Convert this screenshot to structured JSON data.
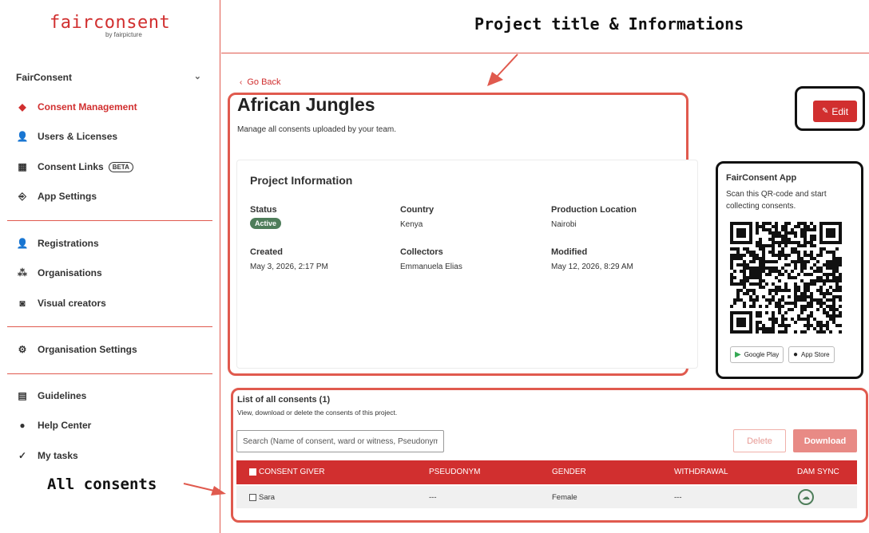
{
  "sidebar": {
    "logo": "fairconsent",
    "logo_sub": "by fairpicture",
    "section": "FairConsent",
    "items": [
      {
        "label": "Consent Management",
        "icon": "consent-icon"
      },
      {
        "label": "Users & Licenses",
        "icon": "users-icon"
      },
      {
        "label": "Consent Links",
        "icon": "qr-links-icon",
        "badge": "BETA"
      },
      {
        "label": "App Settings",
        "icon": "app-settings-icon"
      },
      {
        "label": "Registrations",
        "icon": "add-user-icon"
      },
      {
        "label": "Organisations",
        "icon": "organisations-icon"
      },
      {
        "label": "Visual creators",
        "icon": "camera-icon"
      },
      {
        "label": "Organisation Settings",
        "icon": "gear-icon"
      },
      {
        "label": "Guidelines",
        "icon": "book-icon"
      },
      {
        "label": "Help Center",
        "icon": "help-icon"
      },
      {
        "label": "My tasks",
        "icon": "check-circle-icon"
      }
    ]
  },
  "annotations": {
    "top": "Project title & Informations",
    "consents": "All consents"
  },
  "main": {
    "go_back": "Go Back",
    "title": "African Jungles",
    "subtitle": "Manage all consents uploaded by your team.",
    "edit_label": "Edit"
  },
  "project_info": {
    "heading": "Project Information",
    "status_label": "Status",
    "status_value": "Active",
    "country_label": "Country",
    "country_value": "Kenya",
    "location_label": "Production Location",
    "location_value": "Nairobi",
    "created_label": "Created",
    "created_value": "May 3, 2026, 2:17 PM",
    "collectors_label": "Collectors",
    "collectors_value": "Emmanuela Elias",
    "modified_label": "Modified",
    "modified_value": "May 12, 2026, 8:29 AM"
  },
  "app_card": {
    "title": "FairConsent App",
    "desc": "Scan this QR-code and start collecting consents.",
    "google_play": "Google Play",
    "app_store": "App Store"
  },
  "consents": {
    "title": "List of all consents (1)",
    "subtitle": "View, download or delete the consents of this project.",
    "search_placeholder": "Search (Name of consent, ward or witness, Pseudonym)",
    "delete_label": "Delete",
    "download_label": "Download",
    "columns": [
      "CONSENT GIVER",
      "PSEUDONYM",
      "GENDER",
      "WITHDRAWAL",
      "DAM SYNC"
    ],
    "rows": [
      {
        "giver": "Sara",
        "pseudonym": "---",
        "gender": "Female",
        "withdrawal": "---"
      }
    ]
  },
  "colors": {
    "accent": "#d12f2f",
    "annotation": "#e05a4e",
    "success": "#4e7d5a"
  }
}
